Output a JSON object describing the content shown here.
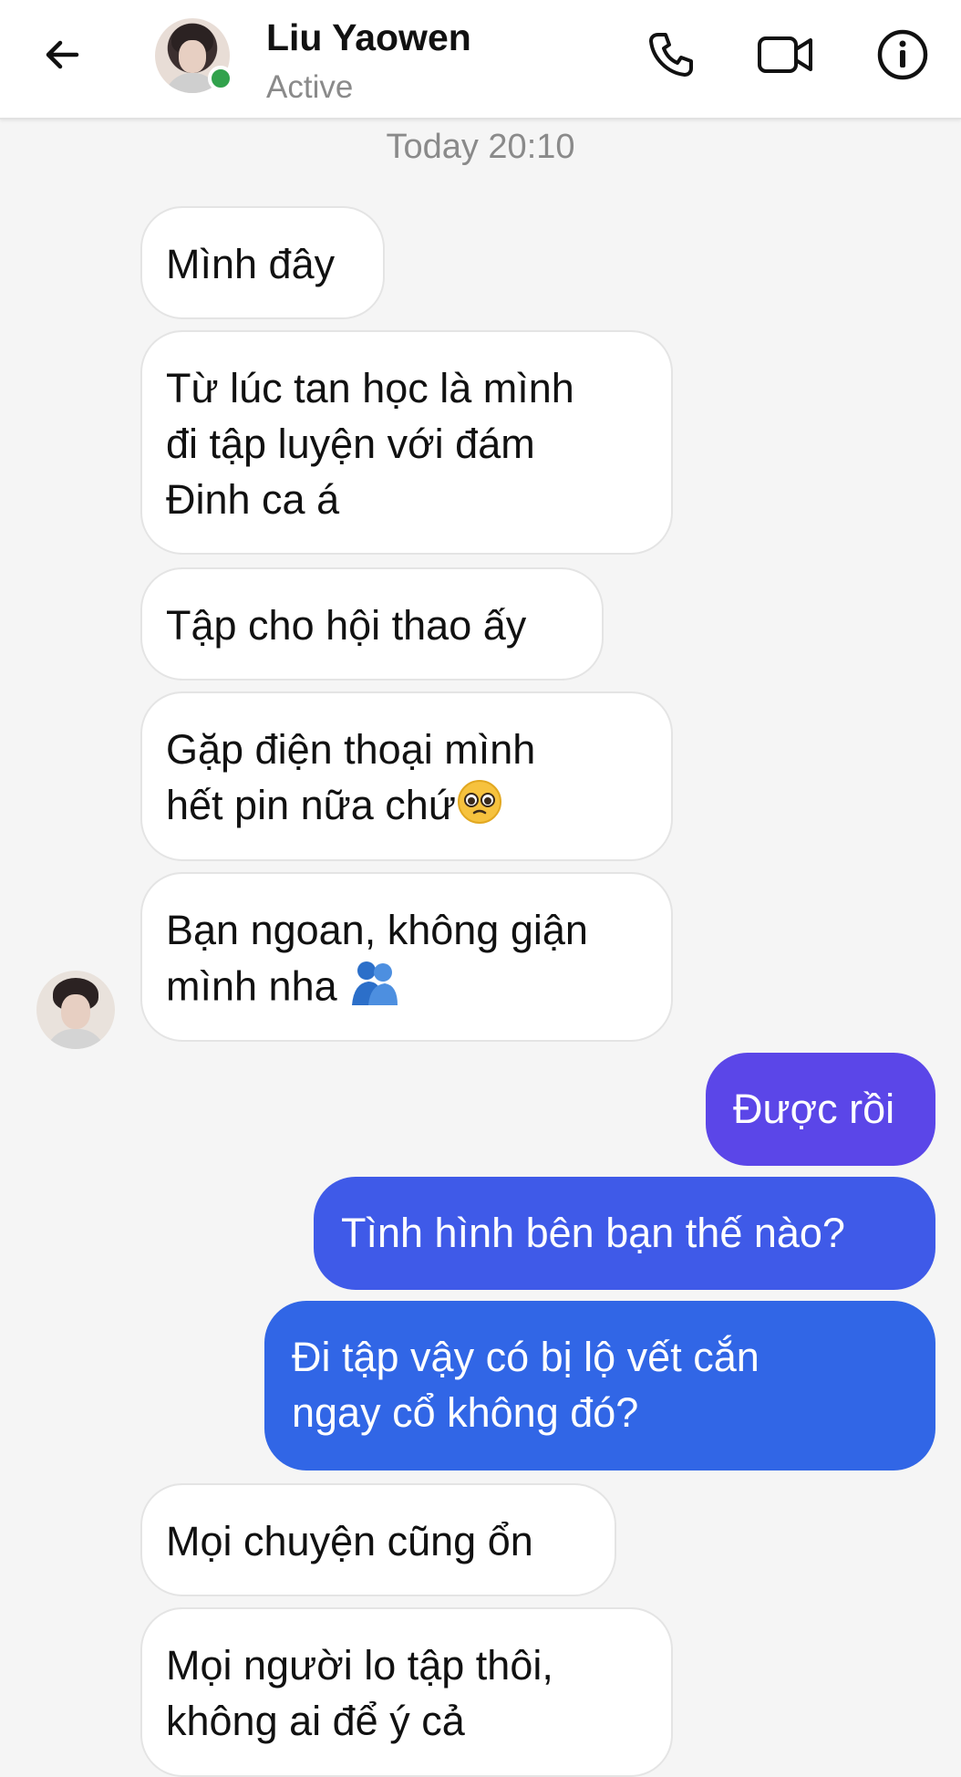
{
  "header": {
    "contact_name": "Liu Yaowen",
    "status": "Active",
    "icons": [
      "back-arrow-icon",
      "phone-icon",
      "video-camera-icon",
      "info-icon"
    ]
  },
  "timestamp": "Today 20:10",
  "colors": {
    "outgoing_top": "#6a3de8",
    "outgoing_bottom": "#2f6ae6",
    "online": "#31a24c"
  },
  "messages": {
    "m1": {
      "lines": [
        "Mình đây"
      ]
    },
    "m2": {
      "lines": [
        "Từ lúc tan học là mình",
        "đi tập luyện với đám",
        "Đinh ca á"
      ]
    },
    "m3": {
      "lines": [
        "Tập cho hội thao ấy"
      ]
    },
    "m4": {
      "lines": [
        "Gặp điện thoại mình",
        "hết pin nữa chứ"
      ],
      "emoji": "pleading-face-emoji"
    },
    "m5": {
      "lines": [
        "Bạn ngoan, không giận",
        "mình nha"
      ],
      "emoji": "people-hugging-emoji"
    },
    "m6": {
      "lines": [
        "Được rồi"
      ]
    },
    "m7": {
      "lines": [
        "Tình hình bên bạn thế nào?"
      ]
    },
    "m8": {
      "lines": [
        "Đi tập vậy có bị lộ vết cắn",
        "ngay cổ không đó?"
      ]
    },
    "m9": {
      "lines": [
        "Mọi chuyện cũng ổn"
      ]
    },
    "m10": {
      "lines": [
        "Mọi người lo tập thôi,",
        "không ai để ý cả"
      ]
    }
  }
}
